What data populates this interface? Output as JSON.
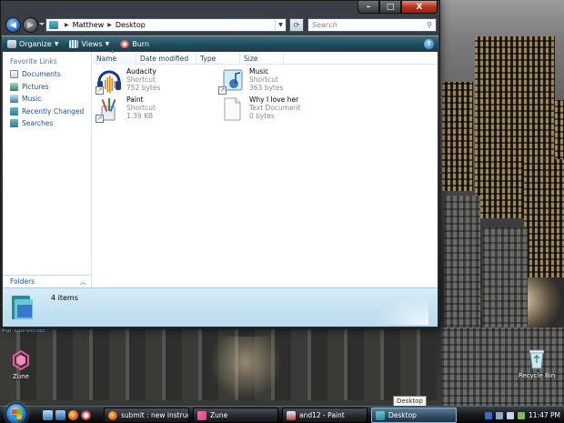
{
  "window": {
    "address": {
      "crumbs": [
        "Matthew",
        "Desktop"
      ]
    },
    "search": {
      "placeholder": "Search"
    },
    "toolbar": {
      "organize": "Organize",
      "views": "Views",
      "burn": "Burn",
      "help": "?"
    },
    "controls": {
      "minimize": "–",
      "maximize": "□",
      "close": "X"
    }
  },
  "navpane": {
    "header": "Favorite Links",
    "items": [
      {
        "label": "Documents",
        "icon": "documents-icon"
      },
      {
        "label": "Pictures",
        "icon": "pictures-icon"
      },
      {
        "label": "Music",
        "icon": "music-icon"
      },
      {
        "label": "Recently Changed",
        "icon": "recent-icon"
      },
      {
        "label": "Searches",
        "icon": "searches-icon"
      }
    ],
    "folders_label": "Folders"
  },
  "columns": [
    "Name",
    "Date modified",
    "Type",
    "Size"
  ],
  "files": [
    {
      "name": "Audacity",
      "type": "Shortcut",
      "size": "752 bytes",
      "icon": "audacity-icon"
    },
    {
      "name": "Music",
      "type": "Shortcut",
      "size": "363 bytes",
      "icon": "music-shortcut-icon"
    },
    {
      "name": "Paint",
      "type": "Shortcut",
      "size": "1.39 KB",
      "icon": "paint-icon"
    },
    {
      "name": "Why I love her",
      "type": "Text Document",
      "size": "0 bytes",
      "icon": "text-document-icon"
    }
  ],
  "details": {
    "count": "4 items"
  },
  "desktop": {
    "gadget_text": "Pdf Converter",
    "icons": [
      {
        "label": "Zune",
        "icon": "zune-icon"
      },
      {
        "label": "Recycle Bin",
        "icon": "recycle-bin-icon"
      }
    ],
    "tooltip": "Desktop"
  },
  "taskbar": {
    "tasks": [
      {
        "label": "submit : new instruc...",
        "icon": "firefox-icon"
      },
      {
        "label": "Zune",
        "icon": "zune-icon"
      },
      {
        "label": "and12 - Paint",
        "icon": "paint-icon"
      },
      {
        "label": "Desktop",
        "icon": "folder-icon"
      }
    ],
    "clock": "11:47 PM"
  }
}
